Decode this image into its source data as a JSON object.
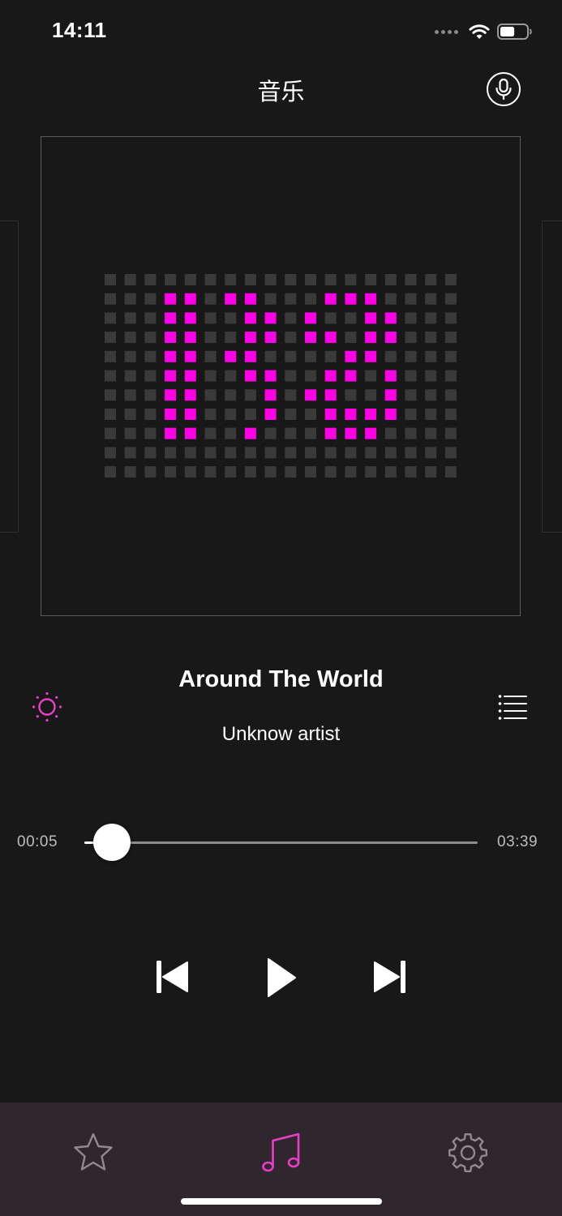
{
  "status_bar": {
    "time": "14:11",
    "signal_icon": "signal-dots-icon",
    "wifi_icon": "wifi-icon",
    "battery_icon": "battery-icon",
    "battery_level": 0.55
  },
  "header": {
    "title": "音乐",
    "mic_icon": "microphone-icon"
  },
  "album": {
    "art_icon": "led-matrix-logo",
    "lit_color": "#ff00e6",
    "dim_color": "#3a3a3a"
  },
  "track": {
    "title": "Around The World",
    "artist": "Unknow artist",
    "light_icon": "sun-icon",
    "playlist_icon": "playlist-icon"
  },
  "progress": {
    "current": "00:05",
    "total": "03:39",
    "fraction": 0.07
  },
  "controls": {
    "prev_icon": "skip-previous-icon",
    "play_icon": "play-icon",
    "next_icon": "skip-next-icon"
  },
  "tab_bar": {
    "tabs": [
      {
        "icon": "star-icon",
        "active": false
      },
      {
        "icon": "music-note-icon",
        "active": true
      },
      {
        "icon": "gear-icon",
        "active": false
      }
    ],
    "active_color": "#e93ec8",
    "inactive_color": "#8e8a8e"
  }
}
